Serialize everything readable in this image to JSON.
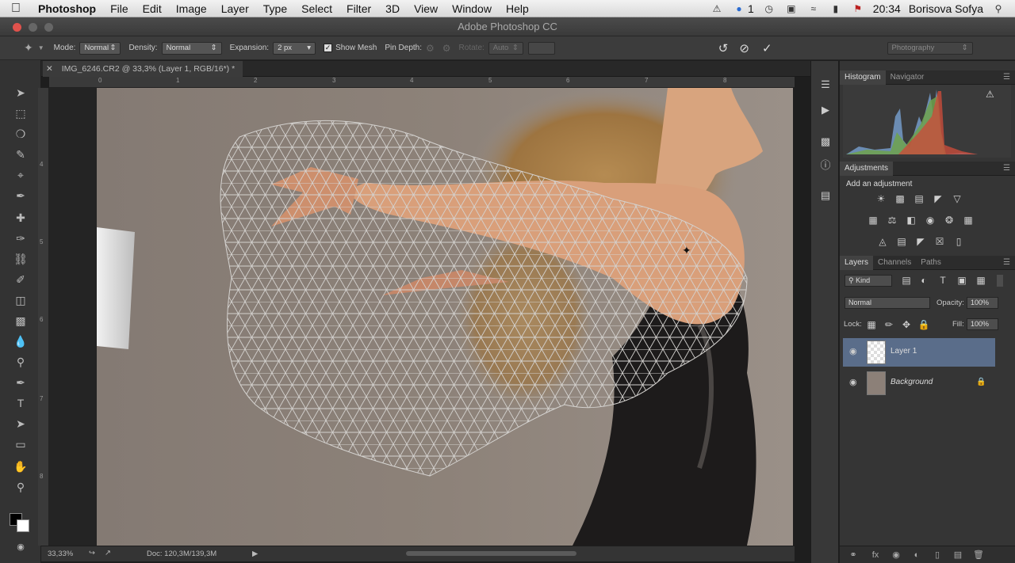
{
  "menubar": {
    "app_name": "Photoshop",
    "items": [
      "File",
      "Edit",
      "Image",
      "Layer",
      "Type",
      "Select",
      "Filter",
      "3D",
      "View",
      "Window",
      "Help"
    ],
    "notification_count": "1",
    "time": "20:34",
    "user": "Borisova Sofya"
  },
  "window": {
    "title": "Adobe Photoshop CC"
  },
  "options": {
    "mode_label": "Mode:",
    "mode_value": "Normal",
    "density_label": "Density:",
    "density_value": "Normal",
    "expansion_label": "Expansion:",
    "expansion_value": "2 px",
    "show_mesh_label": "Show Mesh",
    "pin_depth_label": "Pin Depth:",
    "rotate_label": "Rotate:",
    "rotate_value": "Auto",
    "workspace": "Photography"
  },
  "document": {
    "tab_title": "IMG_6246.CR2 @ 33,3% (Layer 1, RGB/16*) *"
  },
  "rulers": {
    "h": [
      "0",
      "1",
      "2",
      "3",
      "4",
      "5",
      "6",
      "7",
      "8"
    ],
    "v": [
      "4",
      "5",
      "6",
      "7",
      "8"
    ]
  },
  "status": {
    "zoom": "33,33%",
    "doc_size": "Doc: 120,3M/139,3M"
  },
  "panels": {
    "histogram_tab": "Histogram",
    "navigator_tab": "Navigator",
    "adjustments_tab": "Adjustments",
    "add_adjustment": "Add an adjustment",
    "layers_tab": "Layers",
    "channels_tab": "Channels",
    "paths_tab": "Paths",
    "kind_filter": "Kind",
    "blend_mode": "Normal",
    "opacity_label": "Opacity:",
    "opacity_value": "100%",
    "lock_label": "Lock:",
    "fill_label": "Fill:",
    "fill_value": "100%",
    "layers": [
      {
        "name": "Layer 1",
        "selected": true
      },
      {
        "name": "Background",
        "selected": false
      }
    ]
  },
  "colors": {
    "accent_selected_layer": "#5a6d8a",
    "mesh": "#d0cfcd",
    "backdrop": "#8b8179"
  }
}
